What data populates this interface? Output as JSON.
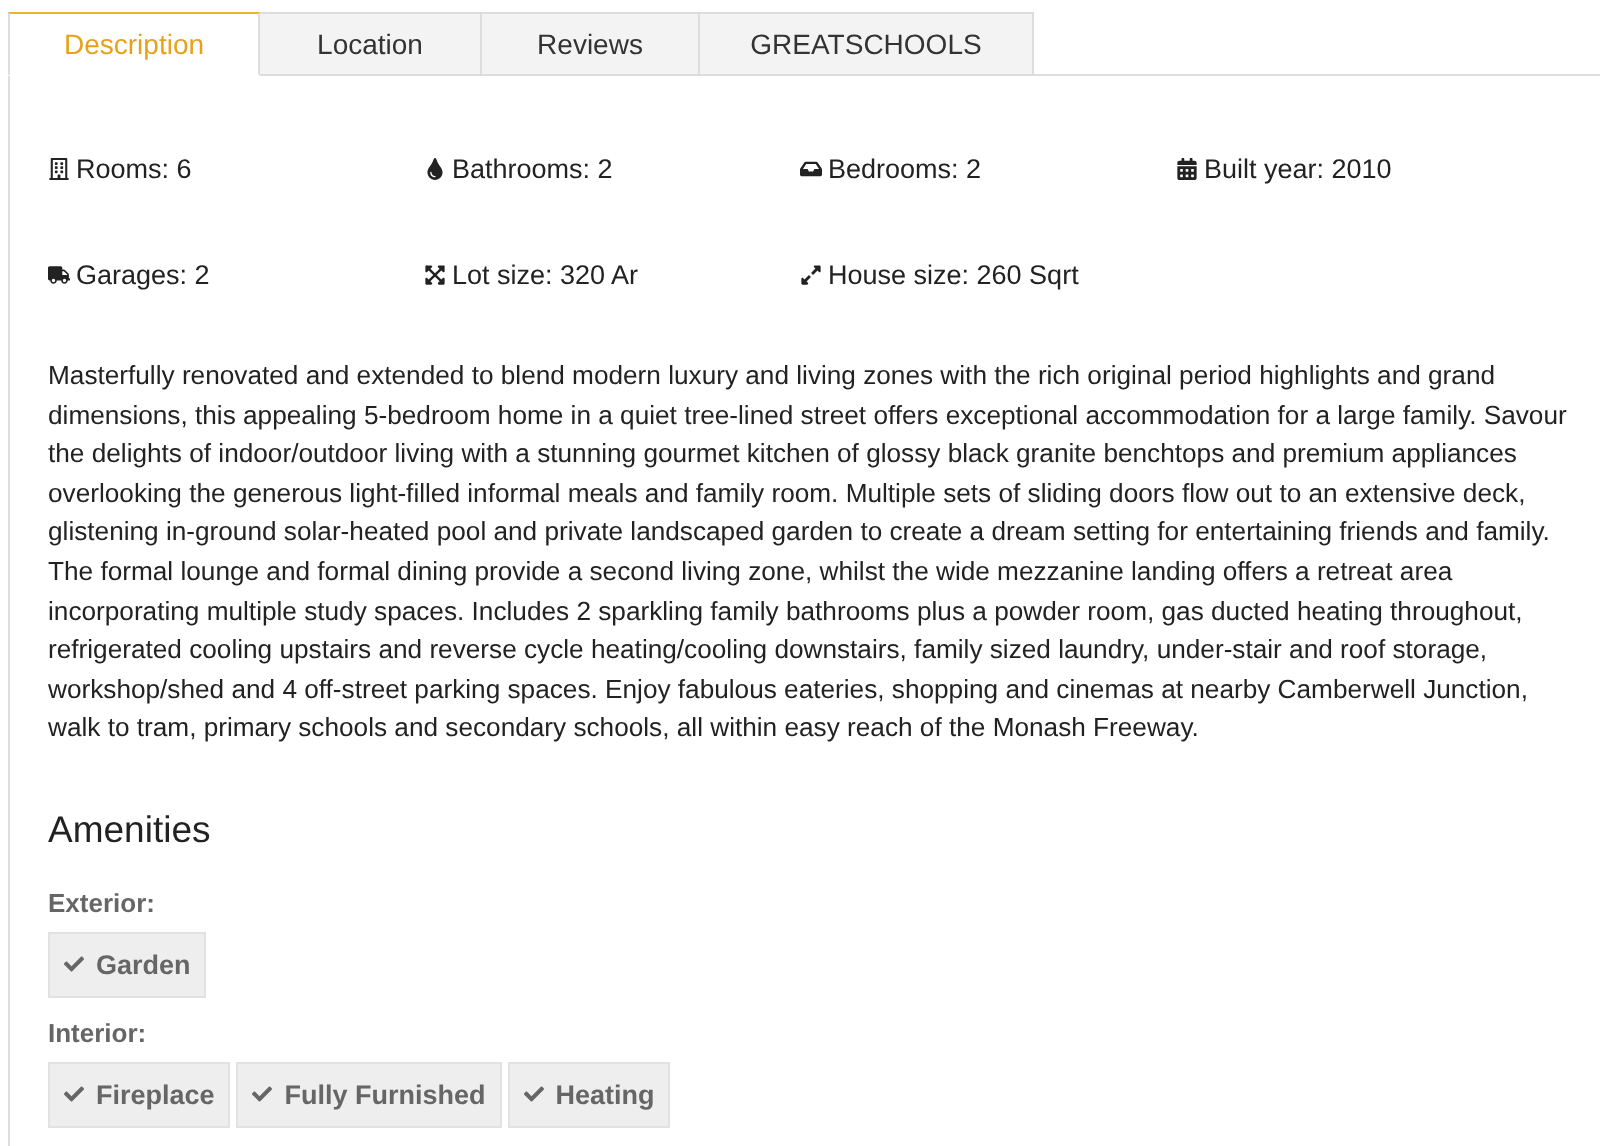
{
  "tabs": [
    {
      "label": "Description",
      "selected": true
    },
    {
      "label": "Location",
      "selected": false
    },
    {
      "label": "Reviews",
      "selected": false
    },
    {
      "label": "GREATSCHOOLS",
      "selected": false
    }
  ],
  "features": [
    {
      "label": "Rooms: 6"
    },
    {
      "label": "Bathrooms: 2"
    },
    {
      "label": "Bedrooms: 2"
    },
    {
      "label": "Built year: 2010"
    },
    {
      "label": "Garages: 2"
    },
    {
      "label": "Lot size: 320 Ar"
    },
    {
      "label": "House size: 260 Sqrt"
    }
  ],
  "description": "Masterfully renovated and extended to blend modern luxury and living zones with the rich original period highlights and grand dimensions, this appealing 5-bedroom home in a quiet tree-lined street offers exceptional accommodation for a large family. Savour the delights of indoor/outdoor living with a stunning gourmet kitchen of glossy black granite benchtops and premium appliances overlooking the generous light-filled informal meals and family room. Multiple sets of sliding doors flow out to an extensive deck, glistening in-ground solar-heated pool and private landscaped garden to create a dream setting for entertaining friends and family. The formal lounge and formal dining provide a second living zone, whilst the wide mezzanine landing offers a retreat area incorporating multiple study spaces. Includes 2 sparkling family bathrooms plus a powder room, gas ducted heating throughout, refrigerated cooling upstairs and reverse cycle heating/cooling downstairs, family sized laundry, under-stair and roof storage, workshop/shed and 4 off-street parking spaces. Enjoy fabulous eateries, shopping and cinemas at nearby Camberwell Junction, walk to tram, primary schools and secondary schools, all within easy reach of the Monash Freeway.",
  "amenities": {
    "title": "Amenities",
    "groups": [
      {
        "label": "Exterior:",
        "items": [
          "Garden"
        ]
      },
      {
        "label": "Interior:",
        "items": [
          "Fireplace",
          "Fully Furnished",
          "Heating"
        ]
      }
    ]
  }
}
